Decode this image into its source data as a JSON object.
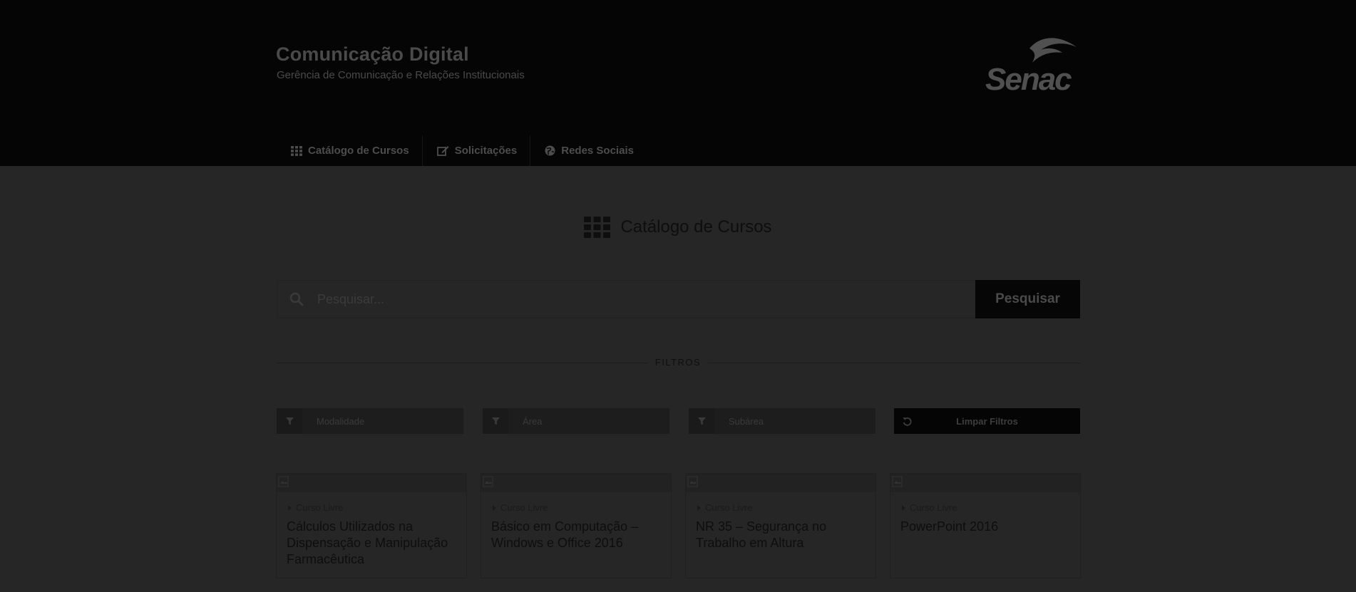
{
  "header": {
    "title": "Comunicação Digital",
    "subtitle": "Gerência de Comunicação e Relações Institucionais",
    "logo_text": "Senac"
  },
  "nav": {
    "items": [
      {
        "label": "Catálogo de Cursos",
        "icon": "grid-icon"
      },
      {
        "label": "Solicitações",
        "icon": "edit-icon"
      },
      {
        "label": "Redes Sociais",
        "icon": "globe-icon"
      }
    ]
  },
  "main": {
    "heading": "Catálogo de Cursos",
    "search": {
      "placeholder": "Pesquisar...",
      "button_label": "Pesquisar"
    },
    "filters": {
      "label": "FILTROS",
      "modalidade": "Modalidade",
      "area": "Área",
      "subarea": "Subárea",
      "clear_label": "Limpar Filtros"
    },
    "courses": [
      {
        "tag": "Curso Livre",
        "title": "Cálculos Utilizados na Dispensação e Manipulação Farmacêutica"
      },
      {
        "tag": "Curso Livre",
        "title": "Básico em Computação – Windows e Office 2016"
      },
      {
        "tag": "Curso Livre",
        "title": "NR 35 – Segurança no Trabalho em Altura"
      },
      {
        "tag": "Curso Livre",
        "title": "PowerPoint 2016"
      }
    ]
  },
  "colors": {
    "overlay_background": "#262626",
    "header_background": "#050505",
    "button_background": "#060606"
  }
}
